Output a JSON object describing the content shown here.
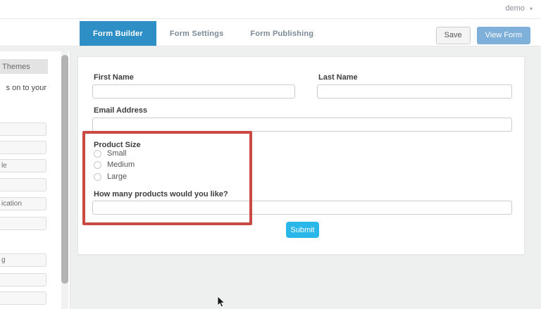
{
  "header": {
    "user_menu_label": "demo",
    "caret": "▾"
  },
  "toolbar": {
    "tabs": [
      {
        "label": "Form Builder",
        "active": true
      },
      {
        "label": "Form Settings",
        "active": false
      },
      {
        "label": "Form Publishing",
        "active": false
      }
    ],
    "save_label": "Save",
    "view_form_label": "View Form"
  },
  "sidebar": {
    "header_label_partial": "Themes",
    "hint_text_partial": "s on to your",
    "field_buttons_partial": [
      "",
      "",
      "le",
      "",
      "ication",
      "",
      "g",
      "",
      ""
    ]
  },
  "form": {
    "first_name_label": "First Name",
    "last_name_label": "Last Name",
    "email_label": "Email Address",
    "product_size_label": "Product Size",
    "radio_options": [
      "Small",
      "Medium",
      "Large"
    ],
    "quantity_label": "How many products would you like?",
    "submit_label": "Submit",
    "input_values": {
      "first_name": "",
      "last_name": "",
      "email": "",
      "quantity": ""
    }
  },
  "colors": {
    "active_tab_blue": "#2e8ec6",
    "view_form_blue": "#7fb0d9",
    "submit_cyan": "#29b7e9",
    "highlight_red": "#c94a42"
  }
}
